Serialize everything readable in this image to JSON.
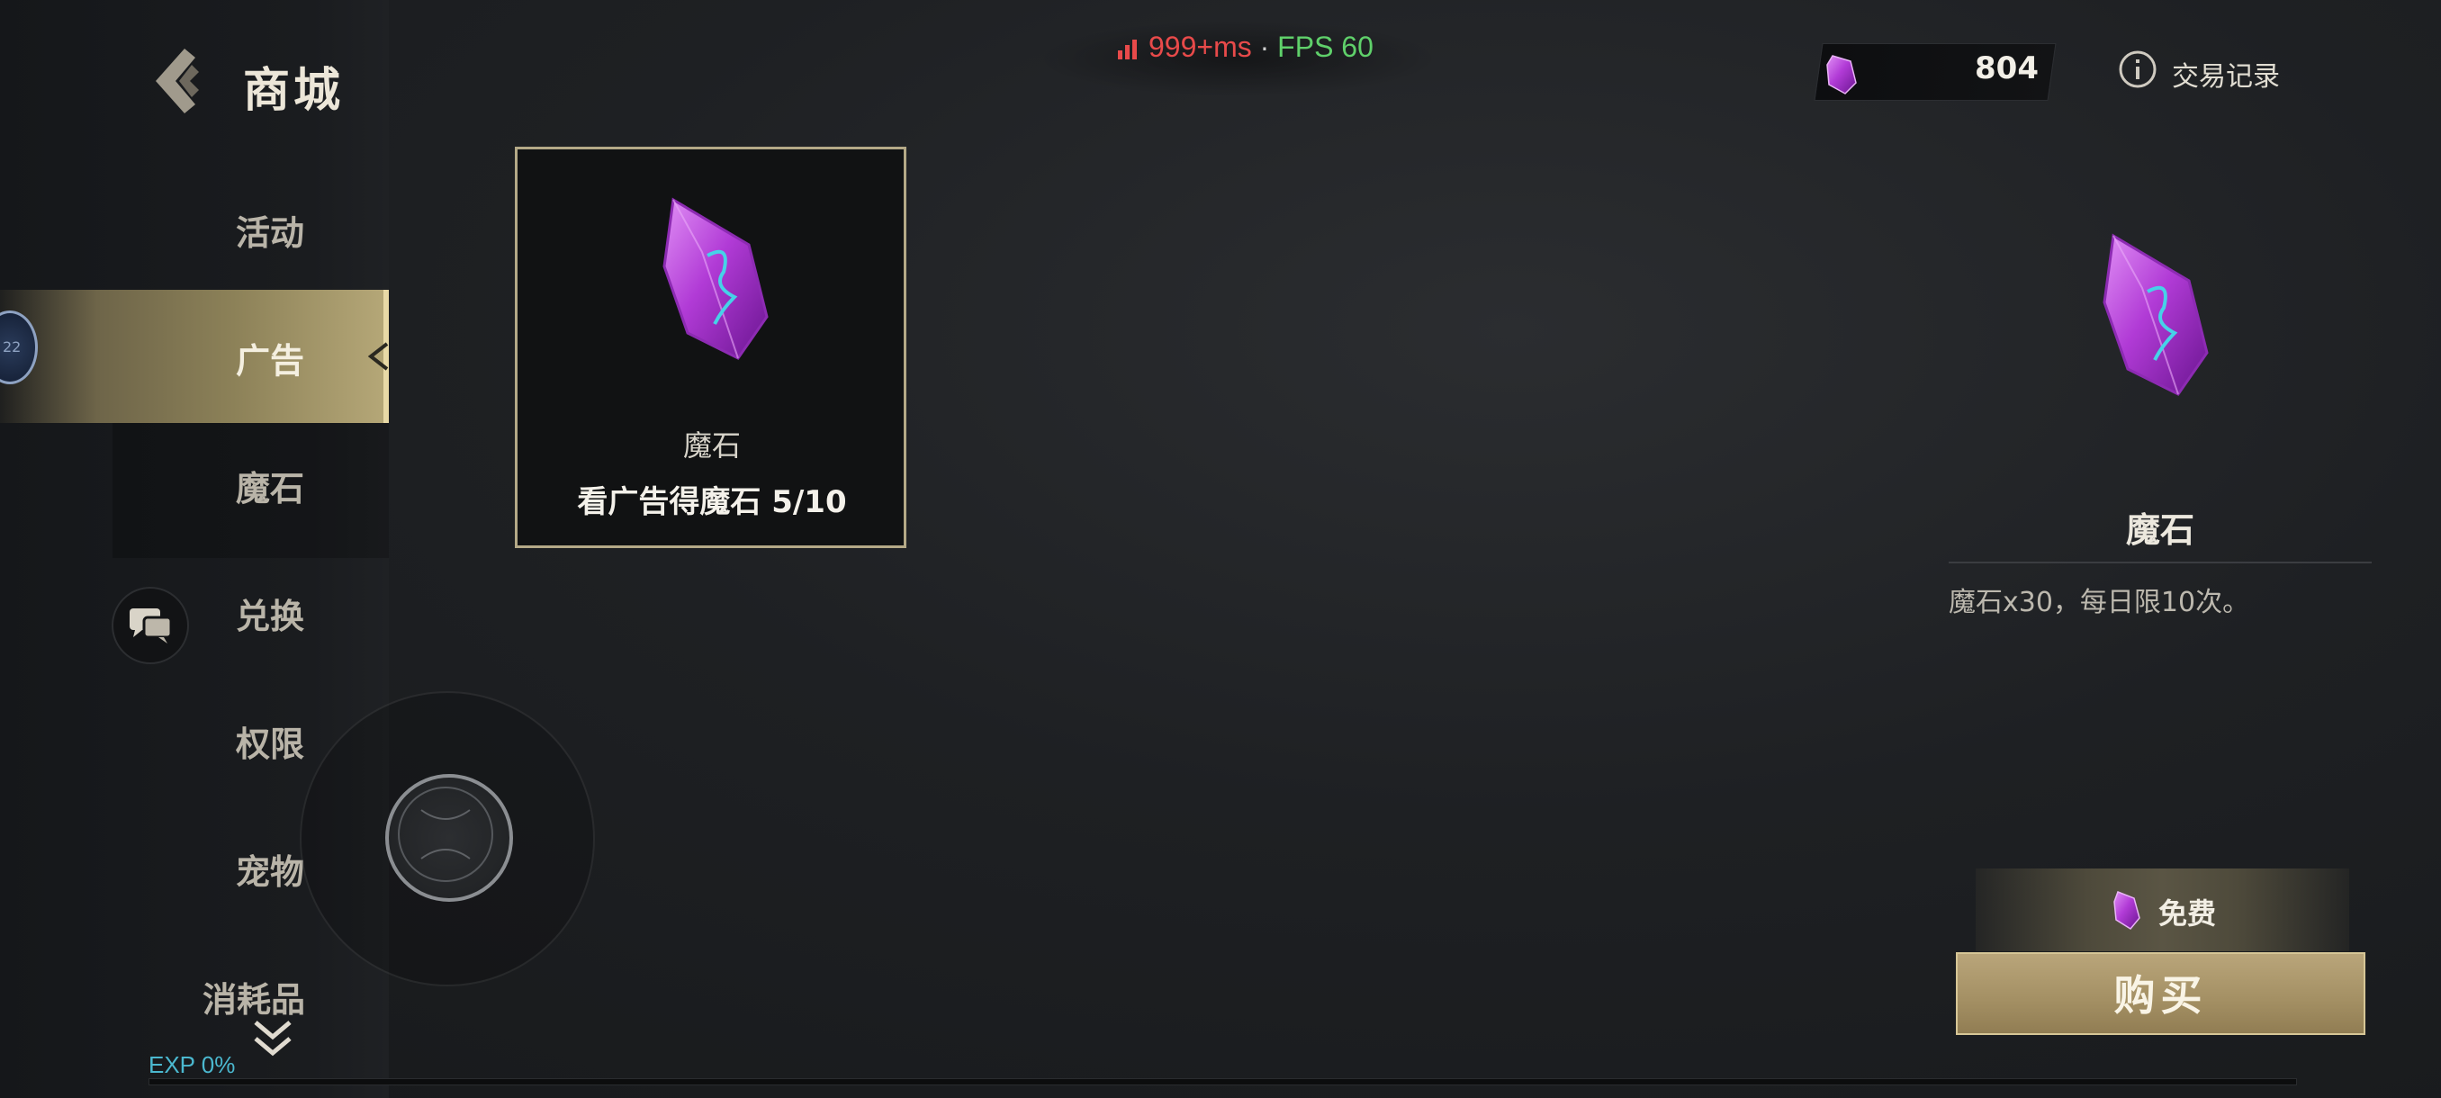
{
  "header": {
    "title": "商城"
  },
  "sidebar": {
    "items": [
      {
        "label": "活动"
      },
      {
        "label": "广告"
      },
      {
        "label": "魔石"
      },
      {
        "label": "兑换"
      },
      {
        "label": "权限"
      },
      {
        "label": "宠物"
      },
      {
        "label": "消耗品"
      }
    ],
    "active_item": "广告"
  },
  "avatar": {
    "text": "22"
  },
  "status": {
    "ping": "999+ms",
    "separator": " · ",
    "fps": "FPS 60"
  },
  "currency": {
    "icon": "magic-stone-icon",
    "amount": "804"
  },
  "trade_record": {
    "label": "交易记录"
  },
  "ad_card": {
    "name": "魔石",
    "desc": "看广告得魔石 5/10"
  },
  "detail": {
    "name": "魔石",
    "desc": "魔石x30，每日限10次。",
    "price_label": "免费",
    "buy_label": "购买"
  },
  "exp": {
    "label": "EXP 0%",
    "percent": 0
  },
  "colors": {
    "accent_gold": "#b4a987",
    "gem_purple": "#b13bd6",
    "exp_cyan": "#4bb8cf",
    "ping_red": "#e84a4a",
    "fps_green": "#5fd06a"
  }
}
